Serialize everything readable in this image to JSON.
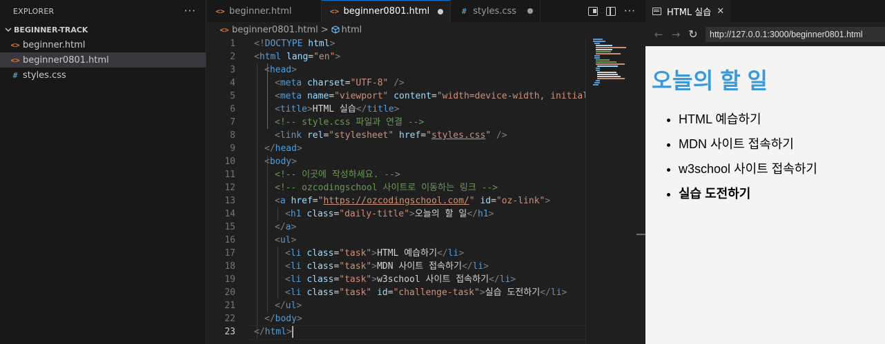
{
  "explorer": {
    "title": "EXPLORER",
    "more_icon": "ellipsis-icon",
    "folder": "BEGINNER-TRACK",
    "files": [
      {
        "name": "beginner.html",
        "type": "html",
        "icon": "<>"
      },
      {
        "name": "beginner0801.html",
        "type": "html",
        "icon": "<>"
      },
      {
        "name": "styles.css",
        "type": "css",
        "icon": "#"
      }
    ]
  },
  "editor": {
    "tabs": [
      {
        "label": "beginner.html",
        "icon": "<>"
      },
      {
        "label": "beginner0801.html",
        "icon": "<>"
      },
      {
        "label": "styles.css",
        "icon": "#"
      }
    ],
    "breadcrumb": {
      "file": "beginner0801.html",
      "sep": ">",
      "symbol": "html"
    },
    "line_numbers": [
      "1",
      "2",
      "3",
      "4",
      "5",
      "6",
      "7",
      "8",
      "9",
      "10",
      "11",
      "12",
      "13",
      "14",
      "15",
      "16",
      "17",
      "18",
      "19",
      "20",
      "21",
      "22",
      "23"
    ],
    "code": {
      "l1": {
        "a": "<!",
        "b": "DOCTYPE",
        "c": "html",
        "d": ">"
      },
      "l2": {
        "a": "<",
        "b": "html",
        "c": "lang",
        "d": "=",
        "e": "\"en\"",
        "f": ">"
      },
      "l3": {
        "a": "<",
        "b": "head",
        "c": ">"
      },
      "l4": {
        "a": "<",
        "b": "meta",
        "c": "charset",
        "d": "=",
        "e": "\"UTF-8\"",
        "f": " />"
      },
      "l5": {
        "a": "<",
        "b": "meta",
        "c": "name",
        "d": "=",
        "e": "\"viewport\"",
        "f": "content",
        "g": "=",
        "h": "\"width=device-width, initial-"
      },
      "l6": {
        "a": "<",
        "b": "title",
        "c": ">",
        "d": "HTML 실습",
        "e": "</",
        "f": "title",
        "g": ">"
      },
      "l7": {
        "a": "<!-- style.css 파일과 연결 -->"
      },
      "l8": {
        "a": "<",
        "b": "link",
        "c": "rel",
        "d": "=",
        "e": "\"stylesheet\"",
        "f": "href",
        "g": "=",
        "h": "\"",
        "i": "styles.css",
        "j": "\"",
        "k": " />"
      },
      "l9": {
        "a": "</",
        "b": "head",
        "c": ">"
      },
      "l10": {
        "a": "<",
        "b": "body",
        "c": ">"
      },
      "l11": {
        "a": "<!-- 이곳에 작성하세요. -->"
      },
      "l12": {
        "a": "<!-- ozcodingschool 사이트로 이동하는 링크 -->"
      },
      "l13": {
        "a": "<",
        "b": "a",
        "c": "href",
        "d": "=",
        "e": "\"",
        "f": "https://ozcodingschool.com/",
        "g": "\"",
        "h": "id",
        "i": "=",
        "j": "\"oz-link\"",
        "k": ">"
      },
      "l14": {
        "a": "<",
        "b": "h1",
        "c": "class",
        "d": "=",
        "e": "\"daily-title\"",
        "f": ">",
        "g": "오늘의 할 일",
        "h": "</",
        "i": "h1",
        "j": ">"
      },
      "l15": {
        "a": "</",
        "b": "a",
        "c": ">"
      },
      "l16": {
        "a": "<",
        "b": "ul",
        "c": ">"
      },
      "l17": {
        "a": "<",
        "b": "li",
        "c": "class",
        "d": "=",
        "e": "\"task\"",
        "f": ">",
        "g": "HTML 예습하기",
        "h": "</",
        "i": "li",
        "j": ">"
      },
      "l18": {
        "a": "<",
        "b": "li",
        "c": "class",
        "d": "=",
        "e": "\"task\"",
        "f": ">",
        "g": "MDN 사이트 접속하기",
        "h": "</",
        "i": "li",
        "j": ">"
      },
      "l19": {
        "a": "<",
        "b": "li",
        "c": "class",
        "d": "=",
        "e": "\"task\"",
        "f": ">",
        "g": "w3school 사이트 접속하기",
        "h": "</",
        "i": "li",
        "j": ">"
      },
      "l20": {
        "a": "<",
        "b": "li",
        "c": "class",
        "d": "=",
        "e": "\"task\"",
        "f": "id",
        "g": "=",
        "h": "\"challenge-task\"",
        "i": ">",
        "j": "실습 도전하기",
        "k": "</",
        "l": "li",
        "m": ">"
      },
      "l21": {
        "a": "</",
        "b": "ul",
        "c": ">"
      },
      "l22": {
        "a": "</",
        "b": "body",
        "c": ">"
      },
      "l23": {
        "a": "</",
        "b": "html",
        "c": ">"
      }
    }
  },
  "browser": {
    "tab_title": "HTML 실습",
    "close": "✕",
    "nav": {
      "back": "←",
      "forward": "→",
      "reload": "↻"
    },
    "url": "http://127.0.0.1:3000/beginner0801.html",
    "page": {
      "heading": "오늘의 할 일",
      "tasks": [
        "HTML 예습하기",
        "MDN 사이트 접속하기",
        "w3school 사이트 접속하기",
        "실습 도전하기"
      ]
    }
  },
  "colors": {
    "tag": "#569cd6",
    "attribute": "#9cdcfe",
    "string": "#ce9178",
    "comment": "#6a9955",
    "heading": "#3a99d8",
    "accent": "#0078d4"
  }
}
